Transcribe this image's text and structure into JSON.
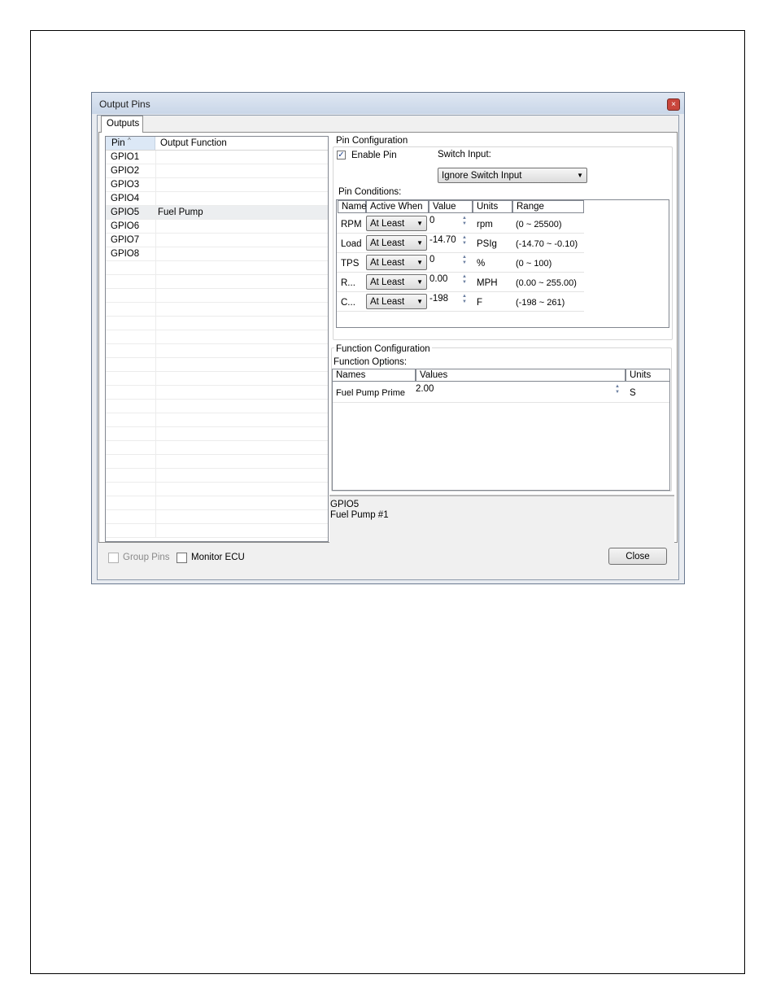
{
  "window": {
    "title": "Output Pins",
    "close_glyph": "×"
  },
  "tabs": [
    {
      "label": "Outputs"
    }
  ],
  "pin_list": {
    "headers": {
      "pin": "Pin",
      "function": "Output Function",
      "sort_glyph": "^"
    },
    "rows": [
      {
        "pin": "GPIO1",
        "function": ""
      },
      {
        "pin": "GPIO2",
        "function": ""
      },
      {
        "pin": "GPIO3",
        "function": ""
      },
      {
        "pin": "GPIO4",
        "function": ""
      },
      {
        "pin": "GPIO5",
        "function": "Fuel Pump"
      },
      {
        "pin": "GPIO6",
        "function": ""
      },
      {
        "pin": "GPIO7",
        "function": ""
      },
      {
        "pin": "GPIO8",
        "function": ""
      }
    ]
  },
  "pin_config": {
    "title": "Pin Configuration",
    "enable_pin": {
      "label": "Enable Pin",
      "checked": true,
      "glyph": "✓"
    },
    "switch_input": {
      "label": "Switch Input:",
      "value": "Ignore Switch Input"
    },
    "conditions_label": "Pin Conditions:",
    "headers": {
      "name": "Name",
      "active": "Active When",
      "value": "Value",
      "units": "Units",
      "range": "Range"
    },
    "rows": [
      {
        "name": "RPM",
        "active": "At Least",
        "value": "0",
        "units": "rpm",
        "range": "(0 ~ 25500)"
      },
      {
        "name": "Load",
        "active": "At Least",
        "value": "-14.70",
        "units": "PSIg",
        "range": "(-14.70 ~ -0.10)"
      },
      {
        "name": "TPS",
        "active": "At Least",
        "value": "0",
        "units": "%",
        "range": "(0 ~ 100)"
      },
      {
        "name": "R...",
        "active": "At Least",
        "value": "0.00",
        "units": "MPH",
        "range": "(0.00 ~ 255.00)"
      },
      {
        "name": "C...",
        "active": "At Least",
        "value": "-198",
        "units": "F",
        "range": "(-198 ~ 261)"
      }
    ]
  },
  "function_config": {
    "title": "Function Configuration",
    "options_label": "Function Options:",
    "headers": {
      "names": "Names",
      "values": "Values",
      "units": "Units"
    },
    "rows": [
      {
        "name": "Fuel Pump Prime",
        "value": "2.00",
        "units": "S"
      }
    ]
  },
  "status": {
    "line1": "GPIO5",
    "line2": "Fuel Pump #1"
  },
  "footer": {
    "group_pins": "Group Pins",
    "monitor_ecu": "Monitor ECU",
    "close": "Close"
  }
}
